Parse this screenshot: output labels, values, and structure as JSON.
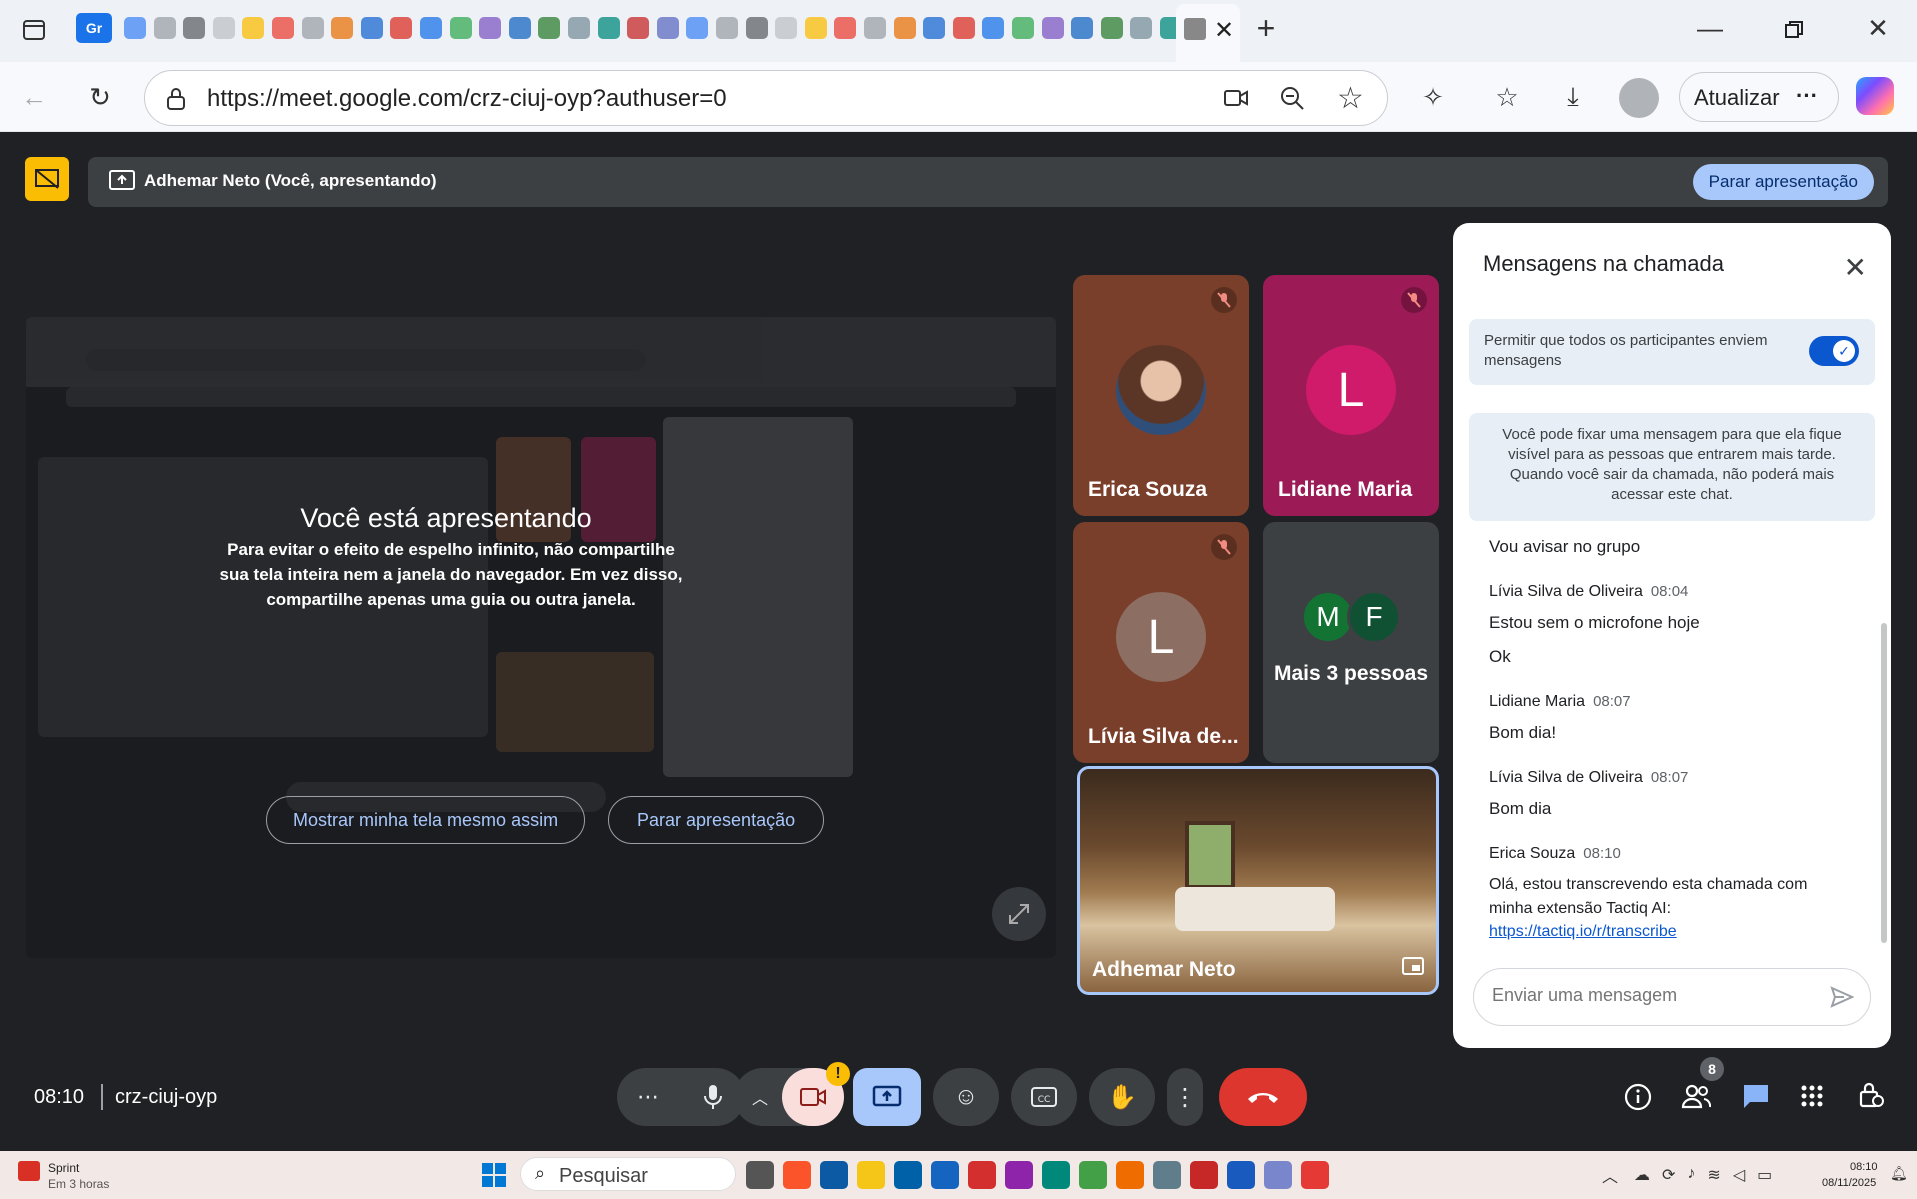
{
  "browser": {
    "tab_gr_label": "Gr",
    "url": "https://meet.google.com/crz-ciuj-oyp?authuser=0",
    "update_button": "Atualizar",
    "more_label": "···"
  },
  "meet": {
    "presenting_bar_label": "Adhemar Neto (Você, apresentando)",
    "stop_presenting_top": "Parar apresentação",
    "overlay_title": "Você está apresentando",
    "overlay_text": "Para evitar o efeito de espelho infinito, não compartilhe sua tela inteira nem a janela do navegador. Em vez disso, compartilhe apenas uma guia ou outra janela.",
    "show_screen_button": "Mostrar minha tela mesmo assim",
    "stop_presenting_button": "Parar apresentação",
    "time": "08:10",
    "meeting_code": "crz-ciuj-oyp",
    "participants_count": "8"
  },
  "tiles": [
    {
      "name": "Erica Souza",
      "bg": "#7a3f2b"
    },
    {
      "name": "Lidiane Maria",
      "initial": "L",
      "bg": "#9c1a55",
      "avatar_color": "#d01b6b"
    },
    {
      "name": "Lívia Silva de...",
      "initial": "L",
      "bg": "#7a3f2b",
      "avatar_color": "#8d6e63"
    },
    {
      "name": "Mais 3 pessoas",
      "initials": [
        "M",
        "F"
      ],
      "bg": "#3c4043"
    },
    {
      "name": "Adhemar Neto"
    }
  ],
  "chat": {
    "title": "Mensagens na chamada",
    "allow_text": "Permitir que todos os participantes enviem mensagens",
    "pin_info": "Você pode fixar uma mensagem para que ela fique visível para as pessoas que entrarem mais tarde. Quando você sair da chamada, não poderá mais acessar este chat.",
    "first_message": "Vou avisar no grupo",
    "messages": [
      {
        "sender": "Lívia Silva de Oliveira",
        "time": "08:04",
        "lines": [
          "Estou sem o microfone hoje",
          "Ok"
        ]
      },
      {
        "sender": "Lidiane Maria",
        "time": "08:07",
        "lines": [
          "Bom dia!"
        ]
      },
      {
        "sender": "Lívia Silva de Oliveira",
        "time": "08:07",
        "lines": [
          "Bom dia"
        ]
      },
      {
        "sender": "Erica Souza",
        "time": "08:10",
        "lines": [
          "Olá, estou transcrevendo esta chamada com minha extensão Tactiq AI:"
        ],
        "link": "https://tactiq.io/r/transcribe"
      }
    ],
    "input_placeholder": "Enviar uma mensagem"
  },
  "taskbar": {
    "notification_title": "Sprint",
    "notification_sub": "Em 3 horas",
    "search_label": "Pesquisar",
    "clock_time": "08:10",
    "clock_date": "08/11/2025"
  },
  "colors": {
    "accent_blue": "#a8c7fa",
    "hangup_red": "#dc362e",
    "present_blue": "#a8c7fa"
  }
}
